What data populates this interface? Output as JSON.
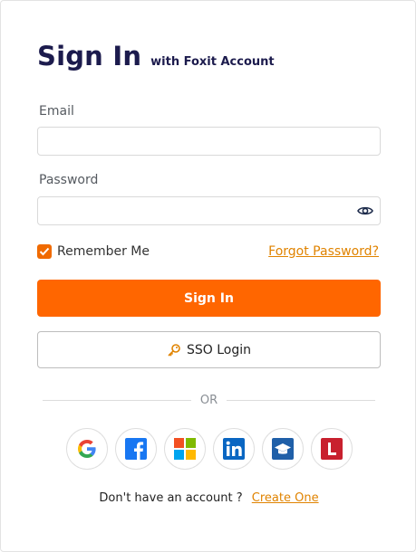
{
  "header": {
    "title": "Sign In",
    "subtitle": "with Foxit Account"
  },
  "form": {
    "email_label": "Email",
    "email_value": "",
    "password_label": "Password",
    "password_value": "",
    "remember_label": "Remember Me",
    "remember_checked": true,
    "forgot_label": "Forgot Password?",
    "signin_label": "Sign In",
    "sso_label": "SSO Login"
  },
  "divider": {
    "text": "OR"
  },
  "socials": [
    {
      "icon": "google-icon"
    },
    {
      "icon": "facebook-icon"
    },
    {
      "icon": "microsoft-icon"
    },
    {
      "icon": "linkedin-icon"
    },
    {
      "icon": "education-icon"
    },
    {
      "icon": "l-icon"
    }
  ],
  "footer": {
    "prompt": "Don't have an account ?",
    "link": "Create One"
  },
  "colors": {
    "primary": "#ff6600",
    "link": "#e08300",
    "title": "#1c1b4d"
  }
}
